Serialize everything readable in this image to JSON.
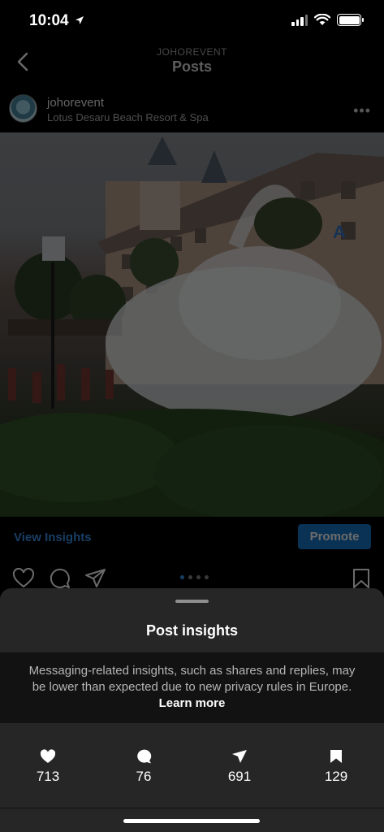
{
  "status": {
    "time": "10:04"
  },
  "header": {
    "account": "JOHOREVENT",
    "title": "Posts"
  },
  "post": {
    "username": "johorevent",
    "location": "Lotus Desaru Beach Resort & Spa",
    "more": "•••",
    "image_description": "Water splash fountain at resort with crowd",
    "sign_letter": "A"
  },
  "insights_bar": {
    "view_insights": "View Insights",
    "promote": "Promote"
  },
  "carousel": {
    "count": 4,
    "active": 0
  },
  "sheet": {
    "title": "Post insights",
    "notice": "Messaging-related insights, such as shares and replies, may be lower than expected due to new privacy rules in Europe.",
    "learn_more": "Learn more",
    "stats": {
      "likes": "713",
      "comments": "76",
      "shares": "691",
      "saves": "129"
    }
  },
  "colors": {
    "link": "#3d95ee",
    "promote": "#1877c9",
    "sheet": "#262626"
  }
}
